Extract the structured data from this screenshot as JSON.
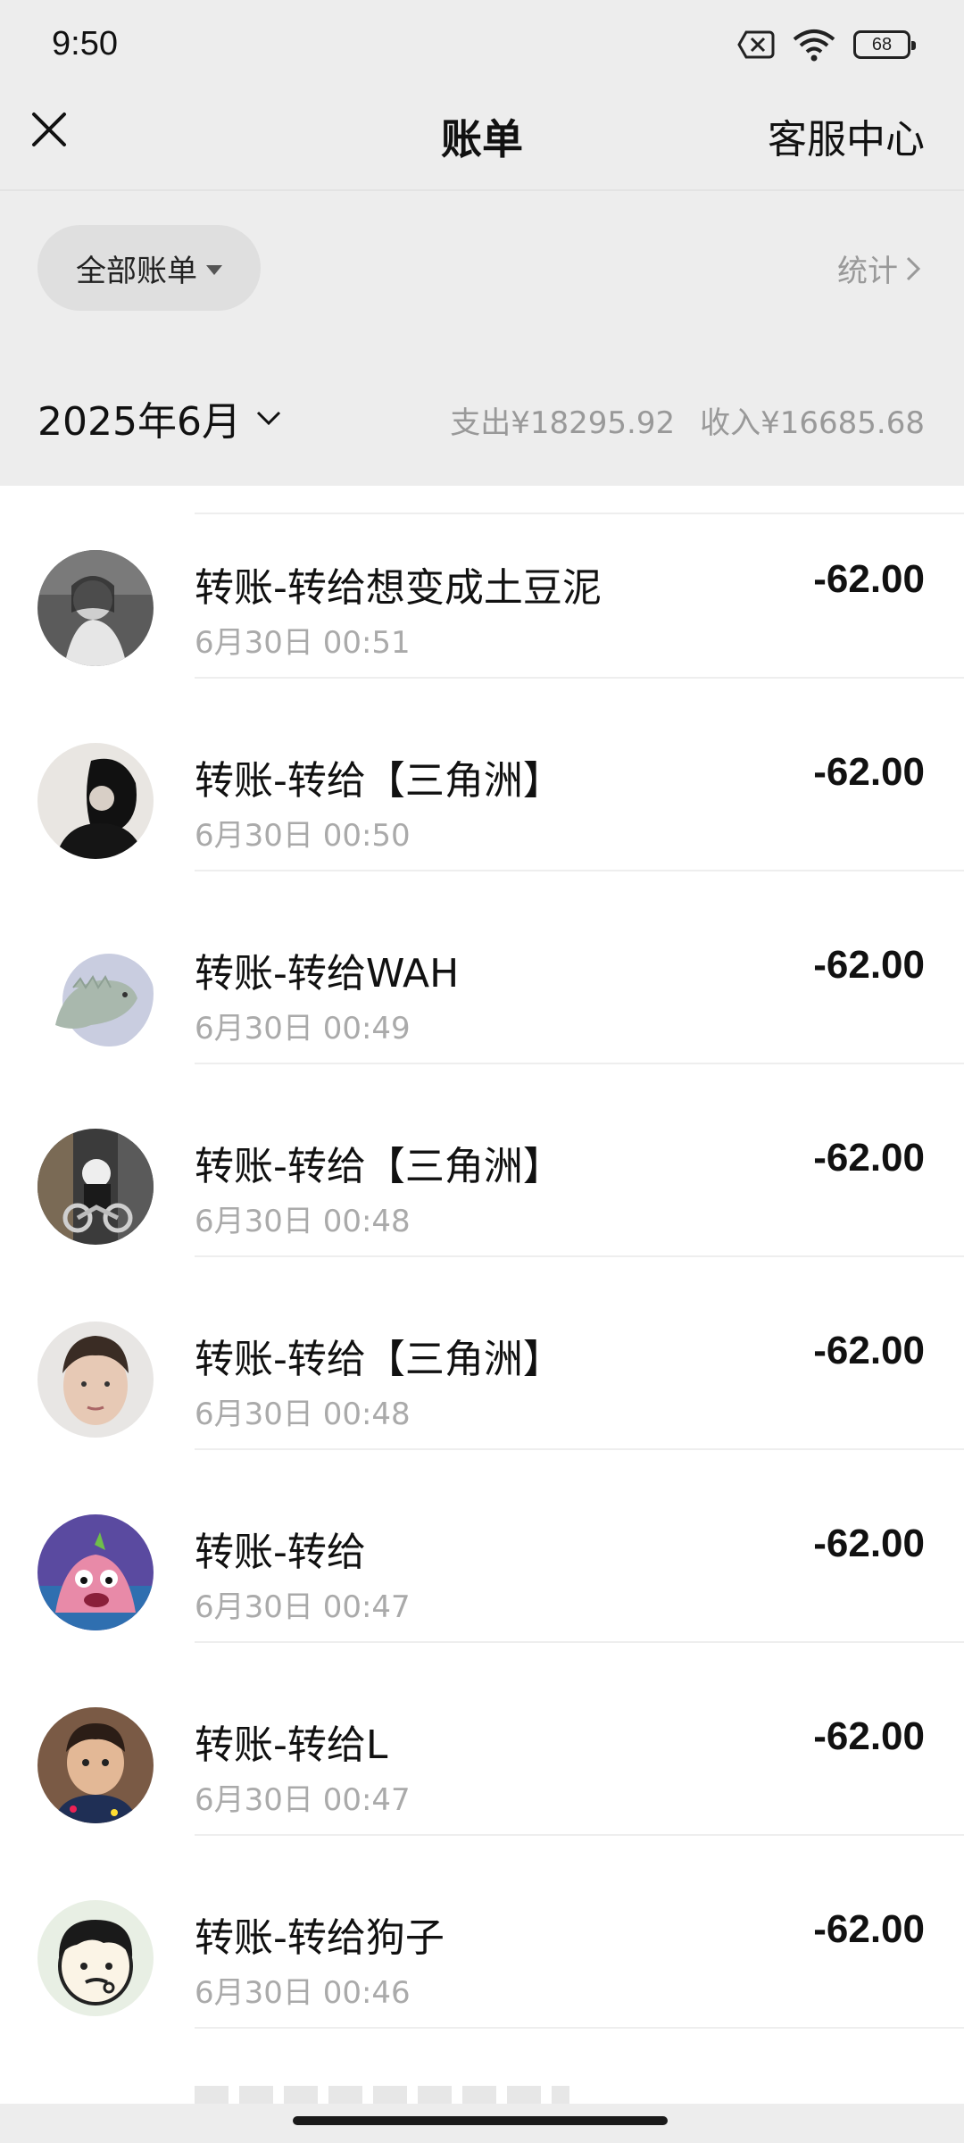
{
  "status_bar": {
    "time": "9:50",
    "battery": "68"
  },
  "nav": {
    "title": "账单",
    "right_link": "客服中心"
  },
  "filter": {
    "pill_label": "全部账单",
    "stats_label": "统计"
  },
  "month": {
    "label": "2025年6月",
    "expense": "支出¥18295.92",
    "income": "收入¥16685.68"
  },
  "transactions": [
    {
      "title": "转账-转给想变成土豆泥",
      "time": "6月30日 00:51",
      "amount": "-62.00",
      "avatar": "photo-avatar-girl"
    },
    {
      "title": "转账-转给【三角洲】",
      "time": "6月30日 00:50",
      "amount": "-62.00",
      "avatar": "photo-avatar-dark"
    },
    {
      "title": "转账-转给WAH",
      "time": "6月30日 00:49",
      "amount": "-62.00",
      "avatar": "dinosaur-avatar"
    },
    {
      "title": "转账-转给【三角洲】",
      "time": "6月30日 00:48",
      "amount": "-62.00",
      "avatar": "motorcycle-avatar"
    },
    {
      "title": "转账-转给【三角洲】",
      "time": "6月30日 00:48",
      "amount": "-62.00",
      "avatar": "boy-face-avatar"
    },
    {
      "title": "转账-转给",
      "time": "6月30日 00:47",
      "amount": "-62.00",
      "avatar": "cartoon-starfish-avatar"
    },
    {
      "title": "转账-转给L",
      "time": "6月30日 00:47",
      "amount": "-62.00",
      "avatar": "kid-photo-avatar"
    },
    {
      "title": "转账-转给狗子",
      "time": "6月30日 00:46",
      "amount": "-62.00",
      "avatar": "cartoon-face-avatar"
    }
  ],
  "colors": {
    "page_bg": "#ededed",
    "list_bg": "#ffffff",
    "muted_text": "#aaaaaa",
    "primary_text": "#111111"
  }
}
